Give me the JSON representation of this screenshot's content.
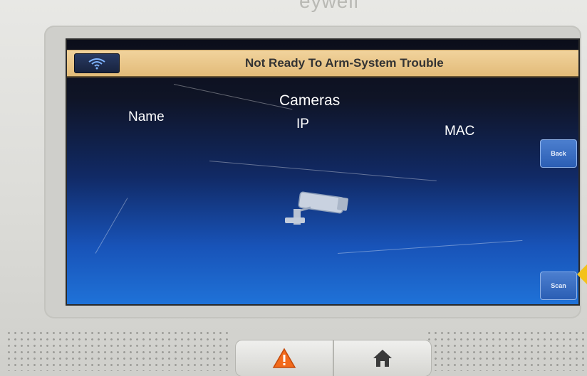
{
  "device": {
    "brand": "eywell"
  },
  "status_bar": {
    "wifi_icon": "wifi-icon",
    "message": "Not Ready To Arm-System Trouble"
  },
  "page": {
    "title": "Cameras",
    "columns": {
      "name": "Name",
      "ip": "IP",
      "mac": "MAC"
    },
    "illustration_icon": "security-camera-icon"
  },
  "side_buttons": {
    "back": "Back",
    "scan": "Scan"
  },
  "hardware_buttons": {
    "alert_icon": "warning-icon",
    "home_icon": "home-icon"
  },
  "colors": {
    "status_bar": "#e2bb78",
    "screen_top": "#0b0e1a",
    "screen_bottom": "#1f72d8",
    "button_blue": "#2b5eb4",
    "warning_orange": "#f26a1b",
    "home_dark": "#3a3a3a"
  }
}
